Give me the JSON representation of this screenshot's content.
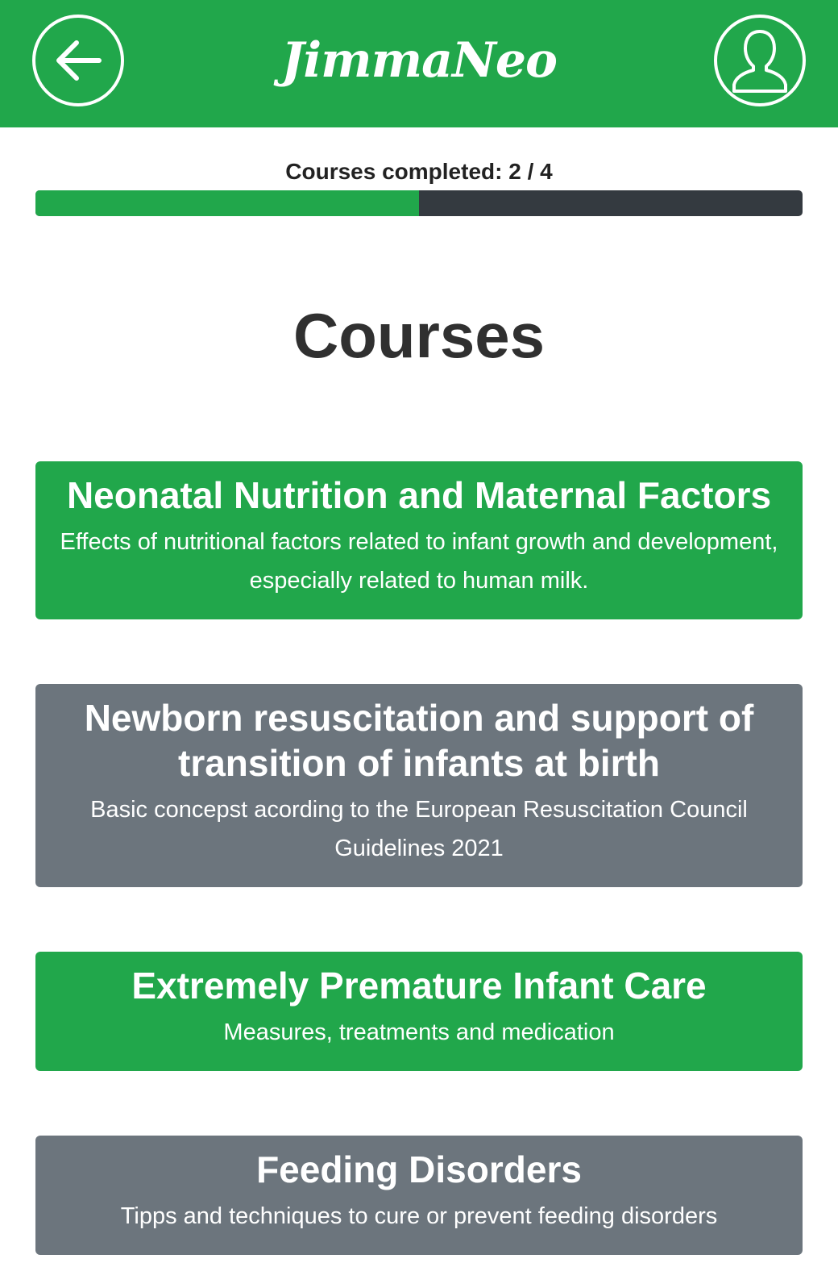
{
  "header": {
    "logo": "JimmaNeo",
    "back_icon": "arrow-left-circle-icon",
    "profile_icon": "user-circle-icon"
  },
  "progress": {
    "label": "Courses completed: 2 / 4",
    "completed": 2,
    "total": 4
  },
  "page_title": "Courses",
  "courses": [
    {
      "title": "Neonatal Nutrition and Maternal Factors",
      "description": "Effects of nutritional factors related to infant growth and development, especially related to human milk.",
      "status": "completed"
    },
    {
      "title": "Newborn resuscitation and support of transition of infants at birth",
      "description": "Basic concepst acording to the European Resuscitation Council Guidelines 2021",
      "status": "pending"
    },
    {
      "title": "Extremely Premature Infant Care",
      "description": "Measures, treatments and medication",
      "status": "completed"
    },
    {
      "title": "Feeding Disorders",
      "description": "Tipps and techniques to cure or prevent feeding disorders",
      "status": "pending"
    }
  ],
  "colors": {
    "brand_green": "#21a74b",
    "pending_gray": "#6c757d",
    "track_dark": "#343a40"
  }
}
